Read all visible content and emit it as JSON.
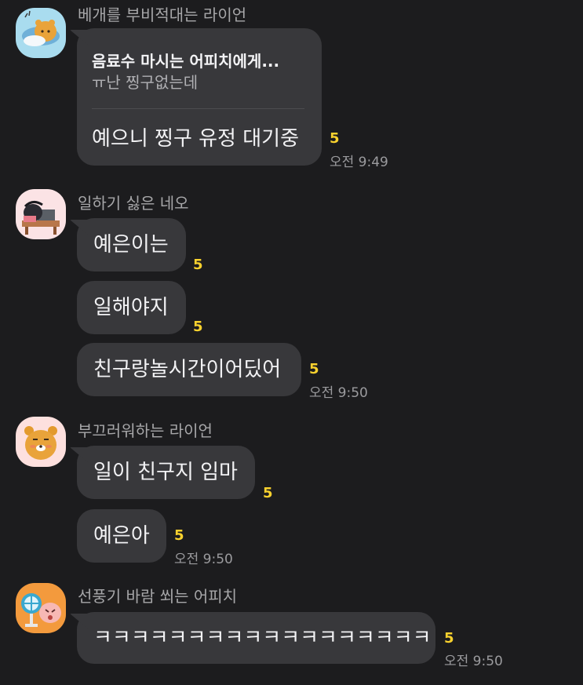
{
  "groups": [
    {
      "sender": "베개를 부비적대는 라이언",
      "avatar_icon": "ryan-pillow-sticker-icon",
      "messages": [
        {
          "type": "reply",
          "quote_title": "음료수 마시는 어피치에게...",
          "quote_text": "ㅠ난 찡구없는데",
          "text": "예으니 찡구 유정 대기중",
          "unread": "5",
          "time": "오전 9:49"
        }
      ]
    },
    {
      "sender": "일하기 싫은 네오",
      "avatar_icon": "neo-desk-sticker-icon",
      "messages": [
        {
          "text": "예은이는",
          "unread": "5"
        },
        {
          "text": "일해야지",
          "unread": "5"
        },
        {
          "text": "친구랑놀시간이어딨어",
          "unread": "5",
          "time": "오전 9:50"
        }
      ]
    },
    {
      "sender": "부끄러워하는 라이언",
      "avatar_icon": "shy-ryan-sticker-icon",
      "messages": [
        {
          "text": "일이 친구지 임마",
          "unread": "5"
        },
        {
          "text": "예은아",
          "unread": "5",
          "time": "오전 9:50"
        }
      ]
    },
    {
      "sender": "선풍기 바람 쐬는 어피치",
      "avatar_icon": "apeach-fan-sticker-icon",
      "messages": [
        {
          "text": "ㅋㅋㅋㅋㅋㅋㅋㅋㅋㅋㅋㅋㅋㅋㅋㅋㅋㅋ",
          "unread": "5",
          "time": "오전 9:50"
        }
      ]
    }
  ],
  "colors": {
    "background": "#1c1c1e",
    "bubble": "#38383b",
    "unread": "#f8d12e",
    "sender": "#a7a7a9",
    "time": "#9b9b9e"
  }
}
